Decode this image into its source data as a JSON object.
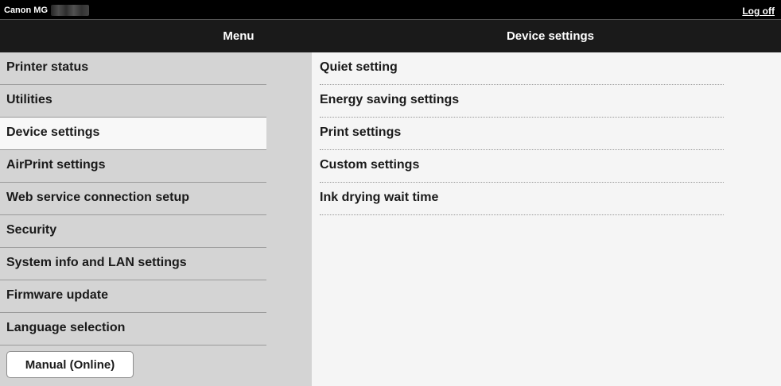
{
  "topbar": {
    "model": "Canon MG",
    "logoff_label": "Log off"
  },
  "titlebar": {
    "menu_title": "Menu",
    "content_title": "Device settings"
  },
  "sidebar": {
    "items": [
      {
        "label": "Printer status"
      },
      {
        "label": "Utilities"
      },
      {
        "label": "Device settings",
        "active": true
      },
      {
        "label": "AirPrint settings"
      },
      {
        "label": "Web service connection setup"
      },
      {
        "label": "Security"
      },
      {
        "label": "System info and LAN settings"
      },
      {
        "label": "Firmware update"
      },
      {
        "label": "Language selection"
      }
    ],
    "manual_button": "Manual (Online)"
  },
  "content": {
    "items": [
      {
        "label": "Quiet setting"
      },
      {
        "label": "Energy saving settings"
      },
      {
        "label": "Print settings"
      },
      {
        "label": "Custom settings"
      },
      {
        "label": "Ink drying wait time"
      }
    ]
  },
  "colors": {
    "topbar_bg": "#000000",
    "titlebar_bg": "#1a1a1a",
    "sidebar_bg": "#d4d4d4",
    "content_bg": "#f5f5f5",
    "active_item_bg": "#f8f8f8"
  }
}
